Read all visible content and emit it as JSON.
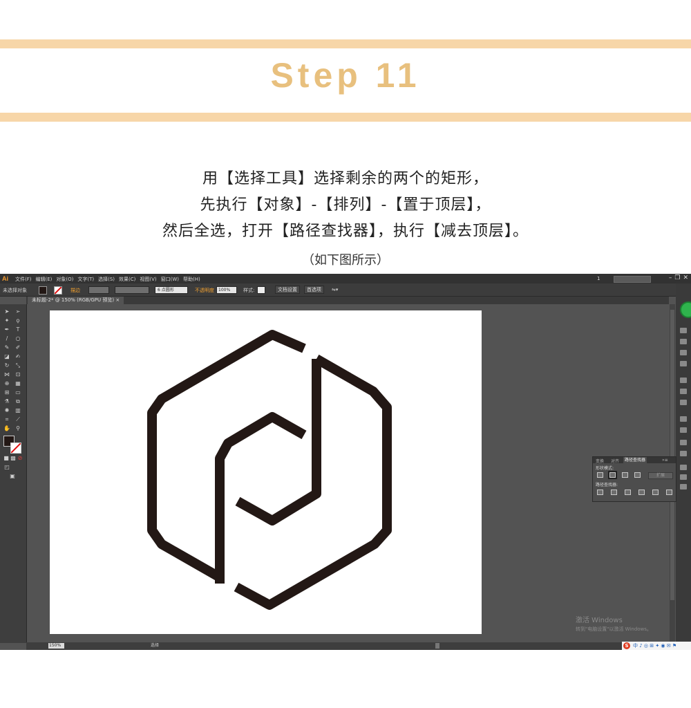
{
  "slide": {
    "title": "Step 11",
    "lines": [
      "用【选择工具】选择剩余的两个的矩形，",
      "先执行【对象】-【排列】-【置于顶层】，",
      "然后全选，打开【路径查找器】，执行【减去顶层】。"
    ],
    "caption": "（如下图所示）"
  },
  "app": {
    "logo": "Ai",
    "menus": [
      "文件(F)",
      "编辑(E)",
      "对象(O)",
      "文字(T)",
      "选择(S)",
      "效果(C)",
      "视图(V)",
      "窗口(W)",
      "帮助(H)"
    ],
    "workspace_number": "1",
    "control": {
      "selection": "未选择对象",
      "stroke_label": "描边",
      "brush_value": "6 点圆形",
      "opacity_label": "不透明度",
      "opacity_value": "100%",
      "style_label": "样式:",
      "doc_setup_btn": "文档设置",
      "prefs_btn": "首选项"
    },
    "doc_tab": "未标题-2* @ 150% (RGB/GPU 预览)",
    "pathfinder": {
      "tabs": [
        "变换",
        "对齐",
        "路径查找器"
      ],
      "shape_modes_label": "形状模式:",
      "pathfinders_label": "路径查找器:",
      "expand_btn": "扩展"
    },
    "status": {
      "zoom": "150%",
      "tool": "选择"
    },
    "watermark": {
      "line1": "激活 Windows",
      "line2": "转到\"电脑设置\"以激活 Windows。"
    },
    "tray_text": "中 ♪ ◎ ⊞ ✦ ◉ ✉ ⚑"
  },
  "colors": {
    "band": "#f7d6a8",
    "title": "#e8c07e",
    "logo_stroke": "#231815",
    "app_bg": "#535353"
  }
}
